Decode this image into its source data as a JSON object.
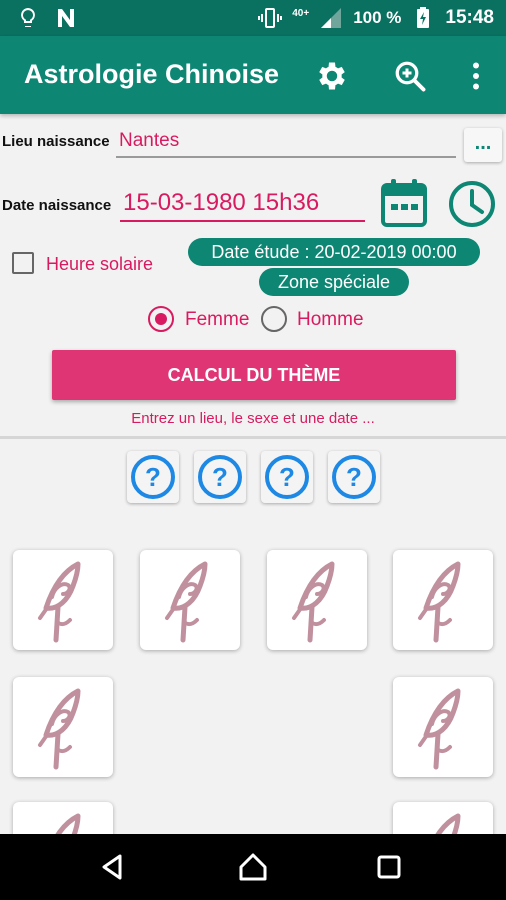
{
  "status_bar": {
    "network_label": "40+",
    "battery_text": "100 %",
    "time": "15:48"
  },
  "app_bar": {
    "title": "Astrologie Chinoise",
    "actions": [
      "gear-icon",
      "search-plus-icon",
      "more-vert-icon"
    ]
  },
  "form": {
    "place_label": "Lieu naissance",
    "place_value": "Nantes",
    "place_more_label": "...",
    "date_label": "Date naissance",
    "date_value": "15-03-1980 15h36",
    "solar_time_label": "Heure solaire",
    "study_date_badge": "Date étude : 20-02-2019 00:00",
    "special_zone_badge": "Zone spéciale",
    "gender_female_label": "Femme",
    "gender_male_label": "Homme",
    "selected_gender": "Femme",
    "calc_button_label": "CALCUL DU THÈME",
    "hint_text": "Entrez un lieu, le sexe et une date ..."
  },
  "question_buttons": [
    "?",
    "?",
    "?",
    "?"
  ],
  "colors": {
    "primary": "#0e8674",
    "primary_dark": "#0a7060",
    "accent": "#e03575",
    "accent_text": "#d81b60",
    "help_blue": "#1e88e5",
    "symbol_mauve": "#c0909e"
  }
}
